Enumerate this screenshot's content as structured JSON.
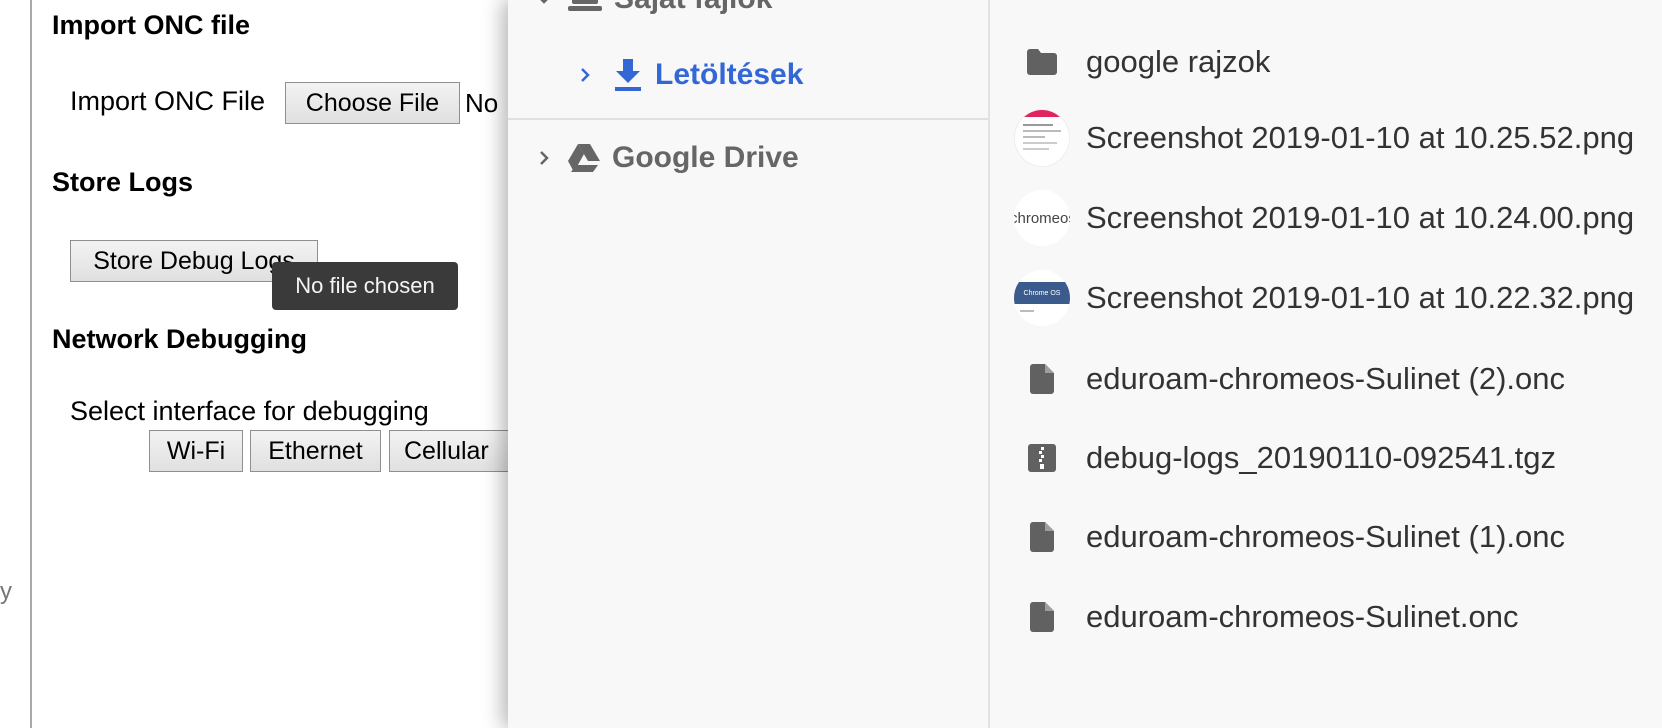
{
  "page": {
    "edge_glyph": "y",
    "sections": [
      {
        "title": "Import ONC file"
      },
      {
        "title": "Store Logs"
      },
      {
        "title": "Network Debugging"
      }
    ],
    "import_label": "Import ONC File",
    "choose_file_label": "Choose File",
    "file_status": "No",
    "store_logs_button": "Store Debug Logs",
    "tooltip": "No file chosen",
    "debug_label": "Select interface for debugging",
    "interfaces": [
      "Wi-Fi",
      "Ethernet",
      "Cellular"
    ]
  },
  "dialog": {
    "nav": {
      "my_files": "Saját fájlok",
      "downloads": "Letöltések",
      "drive": "Google Drive"
    },
    "files": [
      {
        "name": "google rajzok",
        "icon": "folder-icon"
      },
      {
        "name": "Screenshot 2019-01-10 at 10.25.52.png",
        "icon": "image-thumbnail"
      },
      {
        "name": "Screenshot 2019-01-10 at 10.24.00.png",
        "icon": "image-thumbnail",
        "thumb_text": "chromeos"
      },
      {
        "name": "Screenshot 2019-01-10 at 10.22.32.png",
        "icon": "image-thumbnail",
        "thumb_text": "Chrome OS"
      },
      {
        "name": "eduroam-chromeos-Sulinet (2).onc",
        "icon": "file-icon"
      },
      {
        "name": "debug-logs_20190110-092541.tgz",
        "icon": "archive-icon"
      },
      {
        "name": "eduroam-chromeos-Sulinet (1).onc",
        "icon": "file-icon"
      },
      {
        "name": "eduroam-chromeos-Sulinet.onc",
        "icon": "file-icon"
      }
    ]
  },
  "colors": {
    "accent": "#3367d6",
    "nav_text": "#666666",
    "file_text": "#333333",
    "icon": "#616161",
    "tooltip_bg": "#3a3a3a"
  }
}
